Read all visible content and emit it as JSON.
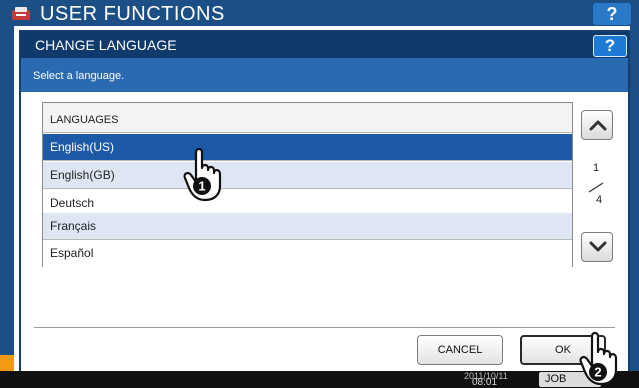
{
  "background": {
    "title": "USER FUNCTIONS",
    "help_label": "?",
    "status": {
      "date": "2011/10/11",
      "time": "08:01",
      "job_status_label": "JOB STATUS"
    }
  },
  "dialog": {
    "title": "CHANGE LANGUAGE",
    "help_label": "?",
    "instruction": "Select a language.",
    "list": {
      "header": "LANGUAGES",
      "items": [
        {
          "label": "English(US)",
          "state": "selected"
        },
        {
          "label": "English(GB)",
          "state": "alt"
        },
        {
          "label": "Deutsch",
          "state": "plain"
        },
        {
          "label": "Français",
          "state": "alt"
        },
        {
          "label": "Español",
          "state": "plain"
        }
      ]
    },
    "pagination": {
      "current": "1",
      "total": "4"
    },
    "buttons": {
      "cancel": "CANCEL",
      "ok": "OK"
    }
  },
  "annotations": {
    "step1": "1",
    "step2": "2"
  },
  "colors": {
    "title_bar": "#0f3a6b",
    "instruction_bar": "#2a6ab0",
    "selected_row": "#1c5aa8",
    "alt_row": "#dde6f2",
    "help_button": "#1f7ad6",
    "status_accent": "#f29a16"
  }
}
